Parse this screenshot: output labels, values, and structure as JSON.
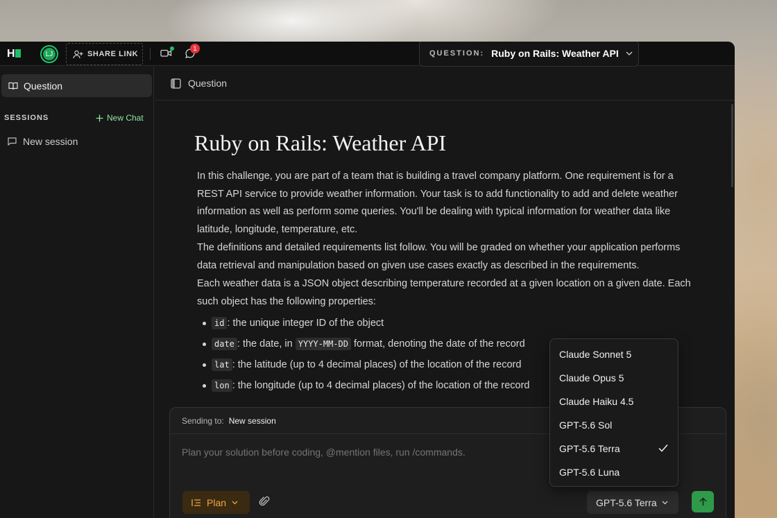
{
  "topbar": {
    "logo_text": "H",
    "avatar_initials": "LJ",
    "share_label": "SHARE LINK",
    "notification_count": "1",
    "question_label": "QUESTION:",
    "question_value": "Ruby on Rails: Weather API"
  },
  "sidebar": {
    "question_tab": "Question",
    "sessions_label": "SESSIONS",
    "new_chat_label": "New Chat",
    "items": [
      {
        "label": "New session"
      }
    ]
  },
  "main": {
    "header_label": "Question",
    "title": "Ruby on Rails: Weather API",
    "paragraphs": [
      "In this challenge, you are part of a team that is building a travel company platform. One requirement is for a REST API service to provide weather information. Your task is to add functionality to add and delete weather information as well as perform some queries. You'll be dealing with typical information for weather data like latitude, longitude, temperature, etc.",
      "The definitions and detailed requirements list follow. You will be graded on whether your application performs data retrieval and manipulation based on given use cases exactly as described in the requirements.",
      "Each weather data is a JSON object describing temperature recorded at a given location on a given date. Each such object has the following properties:"
    ],
    "properties": [
      {
        "code": "id",
        "text": ": the unique integer ID of the object"
      },
      {
        "code": "date",
        "text_before": ": the date, in ",
        "code2": "YYYY-MM-DD",
        "text": " format, denoting the date of the record"
      },
      {
        "code": "lat",
        "text": ": the latitude (up to 4 decimal places) of the location of the record"
      },
      {
        "code": "lon",
        "text": ": the longitude (up to 4 decimal places) of the location of the record"
      }
    ]
  },
  "composer": {
    "sending_label": "Sending to:",
    "sending_value": "New session",
    "placeholder": "Plan your solution before coding, @mention files, run /commands.",
    "plan_label": "Plan",
    "model_label": "GPT-5.6 Terra"
  },
  "model_menu": {
    "options": [
      {
        "label": "Claude Sonnet 5",
        "selected": false
      },
      {
        "label": "Claude Opus 5",
        "selected": false
      },
      {
        "label": "Claude Haiku 4.5",
        "selected": false
      },
      {
        "label": "GPT-5.6 Sol",
        "selected": false
      },
      {
        "label": "GPT-5.6 Terra",
        "selected": true
      },
      {
        "label": "GPT-5.6 Luna",
        "selected": false
      }
    ]
  },
  "colors": {
    "accent_green": "#1fc06a",
    "plan_orange": "#f0a640",
    "badge_red": "#e5343e"
  }
}
